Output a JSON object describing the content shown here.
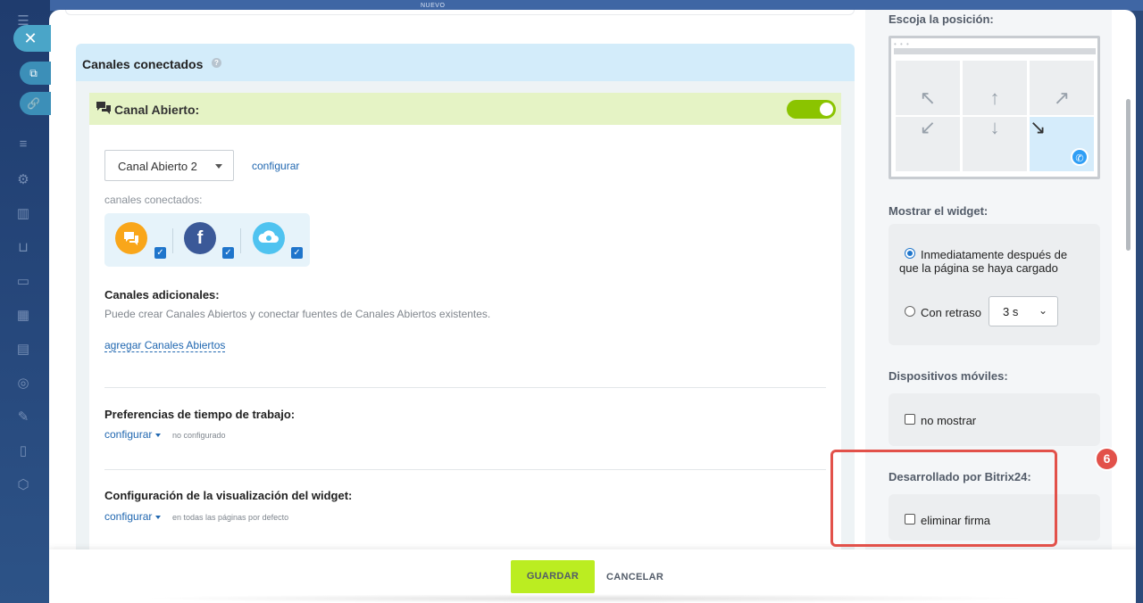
{
  "topbar": {
    "badge": "NUEVO"
  },
  "connected_channels": {
    "title": "Canales conectados",
    "help_glyph": "?",
    "open_channel": {
      "title": "Canal Abierto:",
      "toggle_on": true,
      "select_value": "Canal Abierto 2",
      "configure_label": "configurar",
      "connected_label": "canales conectados:",
      "channels": [
        {
          "icon": "livechat-icon",
          "color": "#f9a61a",
          "checked": true
        },
        {
          "icon": "facebook-icon",
          "color": "#3b5998",
          "checked": true
        },
        {
          "icon": "cloud-icon",
          "color": "#4fc3f0",
          "checked": true
        }
      ]
    },
    "additional": {
      "title": "Canales adicionales:",
      "description": "Puede crear Canales Abiertos y conectar fuentes de Canales Abiertos existentes.",
      "link": "agregar Canales Abiertos"
    },
    "work_time": {
      "title": "Preferencias de tiempo de trabajo:",
      "configure_label": "configurar",
      "note": "no configurado"
    },
    "widget_display": {
      "title": "Configuración de la visualización del widget:",
      "configure_label": "configurar",
      "note": "en todas las páginas por defecto"
    }
  },
  "right_panel": {
    "position_title": "Escoja la posición:",
    "position_selected": "bottom-right",
    "show_widget": {
      "title": "Mostrar el widget:",
      "option_immediate": "Inmediatamente después de que la página se haya cargado",
      "option_delay": "Con retraso",
      "selected": "immediate",
      "delay_value": "3 s"
    },
    "mobile": {
      "title": "Dispositivos móviles:",
      "checkbox_label": "no mostrar",
      "checked": false
    },
    "powered": {
      "title": "Desarrollado por Bitrix24:",
      "checkbox_label": "eliminar firma",
      "checked": false
    },
    "annotation_badge": "6",
    "accent_red": "#e2514a"
  },
  "footer": {
    "save_label": "GUARDAR",
    "cancel_label": "CANCELAR",
    "save_color": "#bbed21"
  }
}
